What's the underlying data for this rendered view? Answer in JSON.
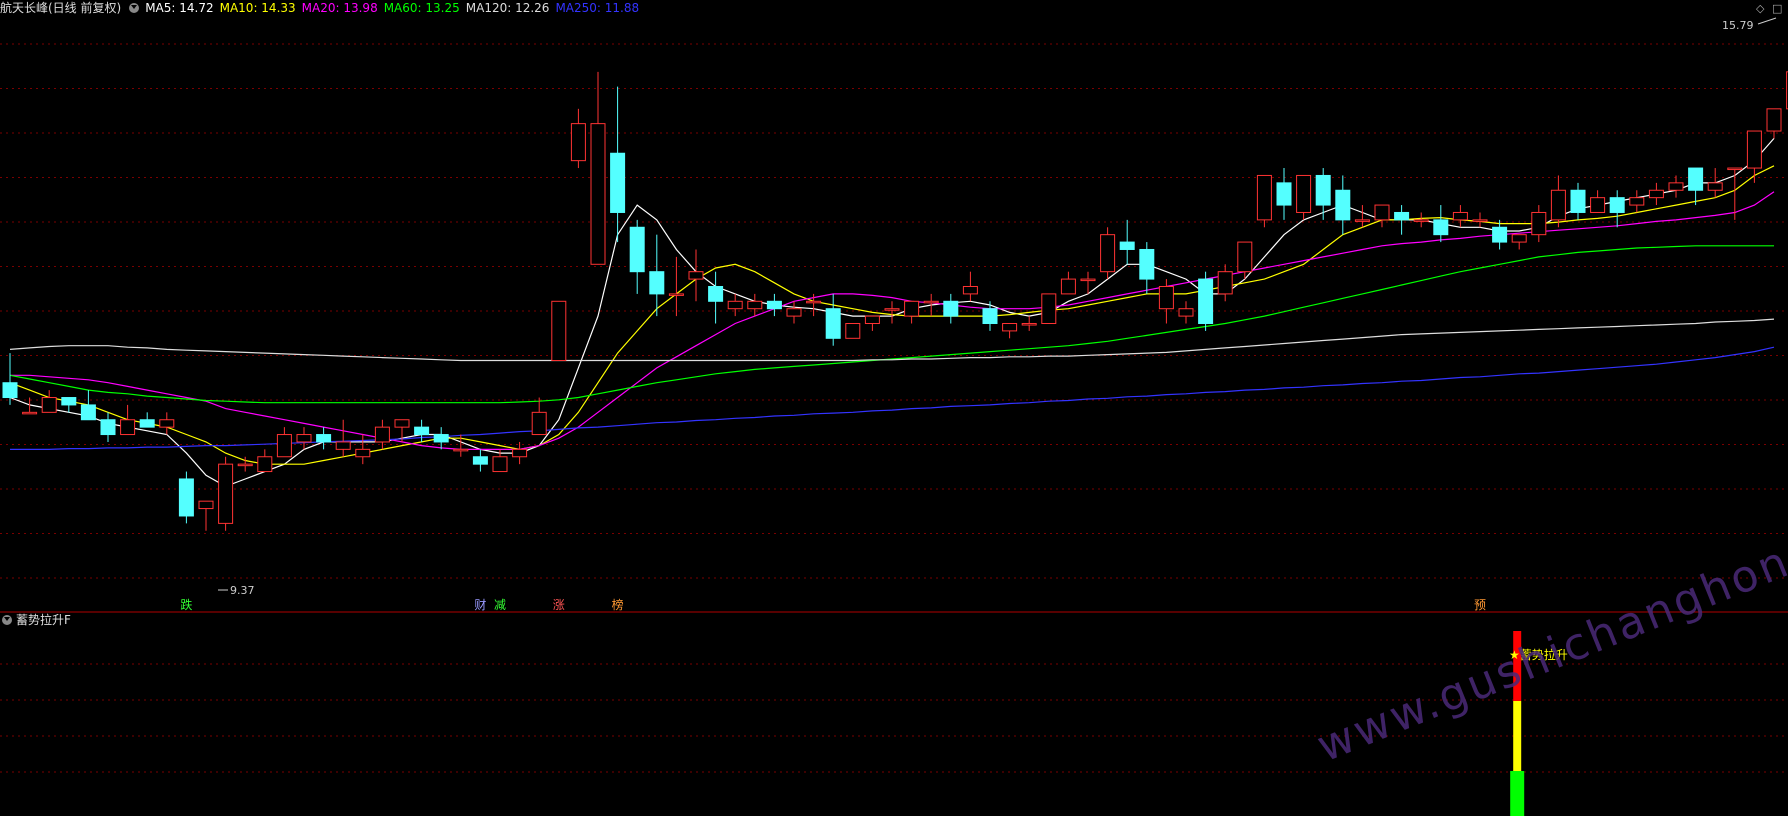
{
  "header": {
    "stock_name": "航天长峰(日线 前复权)",
    "ma_items": [
      {
        "label": "MA5: 14.72",
        "color": "#ffffff"
      },
      {
        "label": "MA10: 14.33",
        "color": "#ffff00"
      },
      {
        "label": "MA20: 13.98",
        "color": "#ff00ff"
      },
      {
        "label": "MA60: 13.25",
        "color": "#00ff00"
      },
      {
        "label": "MA120: 12.26",
        "color": "#dddddd"
      },
      {
        "label": "MA250: 11.88",
        "color": "#3333ff"
      }
    ]
  },
  "indicator": {
    "name": "蓄势拉升F",
    "signal_label": "★蓄势拉升"
  },
  "watermark": "www.gushichanghong.com",
  "colors": {
    "up": "#ff3333",
    "down": "#54ffff",
    "grid": "#7a0000"
  },
  "chart_data": {
    "type": "candlestick",
    "ylim": [
      8.6,
      16.3
    ],
    "max_label": "15.79",
    "min_label": "9.37",
    "candles": [
      [
        11.4,
        11.8,
        11.2,
        11.1
      ],
      [
        11.0,
        11.2,
        11.0,
        11.0
      ],
      [
        11.0,
        11.3,
        11.2,
        11.0
      ],
      [
        11.2,
        11.2,
        11.1,
        11.0
      ],
      [
        11.1,
        11.3,
        10.9,
        10.9
      ],
      [
        10.9,
        11.0,
        10.7,
        10.6
      ],
      [
        10.7,
        11.1,
        10.9,
        10.7
      ],
      [
        10.9,
        11.0,
        10.8,
        10.8
      ],
      [
        10.8,
        11.0,
        10.9,
        10.7
      ],
      [
        10.1,
        10.2,
        9.6,
        9.5
      ],
      [
        9.7,
        9.8,
        9.8,
        9.4
      ],
      [
        9.5,
        10.4,
        10.3,
        9.4
      ],
      [
        10.3,
        10.4,
        10.3,
        10.2
      ],
      [
        10.2,
        10.5,
        10.4,
        10.2
      ],
      [
        10.4,
        10.8,
        10.7,
        10.4
      ],
      [
        10.6,
        10.8,
        10.7,
        10.5
      ],
      [
        10.7,
        10.8,
        10.6,
        10.5
      ],
      [
        10.5,
        10.9,
        10.6,
        10.4
      ],
      [
        10.4,
        10.7,
        10.5,
        10.3
      ],
      [
        10.6,
        10.9,
        10.8,
        10.5
      ],
      [
        10.8,
        10.9,
        10.9,
        10.6
      ],
      [
        10.8,
        10.9,
        10.7,
        10.6
      ],
      [
        10.7,
        10.8,
        10.6,
        10.5
      ],
      [
        10.5,
        10.7,
        10.5,
        10.4
      ],
      [
        10.4,
        10.5,
        10.3,
        10.2
      ],
      [
        10.2,
        10.5,
        10.4,
        10.2
      ],
      [
        10.4,
        10.6,
        10.5,
        10.3
      ],
      [
        10.7,
        11.2,
        11.0,
        10.7
      ],
      [
        11.7,
        12.5,
        12.5,
        11.7
      ],
      [
        14.4,
        15.1,
        14.9,
        14.3
      ],
      [
        13.0,
        15.6,
        14.9,
        13.0
      ],
      [
        14.5,
        15.4,
        13.7,
        13.3
      ],
      [
        13.5,
        13.6,
        12.9,
        12.6
      ],
      [
        12.9,
        13.4,
        12.6,
        12.3
      ],
      [
        12.6,
        13.1,
        12.6,
        12.3
      ],
      [
        12.8,
        13.2,
        12.9,
        12.5
      ],
      [
        12.7,
        12.9,
        12.5,
        12.2
      ],
      [
        12.4,
        12.6,
        12.5,
        12.3
      ],
      [
        12.4,
        12.6,
        12.5,
        12.3
      ],
      [
        12.5,
        12.6,
        12.4,
        12.3
      ],
      [
        12.3,
        12.5,
        12.4,
        12.2
      ],
      [
        12.5,
        12.6,
        12.5,
        12.3
      ],
      [
        12.4,
        12.6,
        12.0,
        11.9
      ],
      [
        12.0,
        12.2,
        12.2,
        12.0
      ],
      [
        12.2,
        12.3,
        12.3,
        12.1
      ],
      [
        12.4,
        12.5,
        12.4,
        12.2
      ],
      [
        12.3,
        12.5,
        12.5,
        12.2
      ],
      [
        12.5,
        12.6,
        12.5,
        12.3
      ],
      [
        12.5,
        12.6,
        12.3,
        12.2
      ],
      [
        12.6,
        12.9,
        12.7,
        12.5
      ],
      [
        12.4,
        12.5,
        12.2,
        12.1
      ],
      [
        12.1,
        12.2,
        12.2,
        12.0
      ],
      [
        12.2,
        12.3,
        12.2,
        12.1
      ],
      [
        12.2,
        12.5,
        12.6,
        12.2
      ],
      [
        12.6,
        12.9,
        12.8,
        12.6
      ],
      [
        12.8,
        12.9,
        12.8,
        12.6
      ],
      [
        12.9,
        13.5,
        13.4,
        12.8
      ],
      [
        13.3,
        13.6,
        13.2,
        13.0
      ],
      [
        13.2,
        13.3,
        12.8,
        12.6
      ],
      [
        12.4,
        12.8,
        12.7,
        12.2
      ],
      [
        12.3,
        12.5,
        12.4,
        12.2
      ],
      [
        12.8,
        12.9,
        12.2,
        12.1
      ],
      [
        12.6,
        13.0,
        12.9,
        12.5
      ],
      [
        12.9,
        13.2,
        13.3,
        12.8
      ],
      [
        13.6,
        14.1,
        14.2,
        13.5
      ],
      [
        14.1,
        14.3,
        13.8,
        13.6
      ],
      [
        13.7,
        14.2,
        14.2,
        13.6
      ],
      [
        14.2,
        14.3,
        13.8,
        13.6
      ],
      [
        14.0,
        14.2,
        13.6,
        13.4
      ],
      [
        13.6,
        13.8,
        13.6,
        13.5
      ],
      [
        13.6,
        13.8,
        13.8,
        13.5
      ],
      [
        13.7,
        13.8,
        13.6,
        13.4
      ],
      [
        13.6,
        13.7,
        13.6,
        13.5
      ],
      [
        13.6,
        13.8,
        13.4,
        13.3
      ],
      [
        13.6,
        13.8,
        13.7,
        13.5
      ],
      [
        13.6,
        13.7,
        13.6,
        13.5
      ],
      [
        13.5,
        13.6,
        13.3,
        13.2
      ],
      [
        13.3,
        13.4,
        13.4,
        13.2
      ],
      [
        13.4,
        13.8,
        13.7,
        13.3
      ],
      [
        13.6,
        14.2,
        14.0,
        13.5
      ],
      [
        14.0,
        14.1,
        13.7,
        13.6
      ],
      [
        13.7,
        14.0,
        13.9,
        13.7
      ],
      [
        13.9,
        14.0,
        13.7,
        13.5
      ],
      [
        13.8,
        14.0,
        13.9,
        13.7
      ],
      [
        13.9,
        14.1,
        14.0,
        13.8
      ],
      [
        14.0,
        14.2,
        14.1,
        13.9
      ],
      [
        14.3,
        14.3,
        14.0,
        13.8
      ],
      [
        14.0,
        14.3,
        14.1,
        13.9
      ],
      [
        14.3,
        14.3,
        14.3,
        13.6
      ],
      [
        14.3,
        14.5,
        14.8,
        14.1
      ],
      [
        14.8,
        14.8,
        15.1,
        14.7
      ],
      [
        15.1,
        15.6,
        15.6,
        15.0
      ]
    ],
    "ma_lines": [
      {
        "name": "MA5",
        "color": "#ffffff",
        "values": [
          11.2,
          11.1,
          11.05,
          11.0,
          10.95,
          10.85,
          10.8,
          10.75,
          10.7,
          10.45,
          10.15,
          10.0,
          10.1,
          10.2,
          10.3,
          10.5,
          10.6,
          10.6,
          10.6,
          10.6,
          10.65,
          10.7,
          10.7,
          10.6,
          10.5,
          10.45,
          10.45,
          10.55,
          10.9,
          11.6,
          12.3,
          13.4,
          13.8,
          13.6,
          13.2,
          12.9,
          12.7,
          12.6,
          12.5,
          12.45,
          12.42,
          12.4,
          12.35,
          12.3,
          12.3,
          12.3,
          12.4,
          12.45,
          12.48,
          12.5,
          12.45,
          12.35,
          12.3,
          12.35,
          12.5,
          12.6,
          12.8,
          13.0,
          13.0,
          12.9,
          12.8,
          12.6,
          12.6,
          12.8,
          13.1,
          13.4,
          13.6,
          13.7,
          13.8,
          13.7,
          13.6,
          13.6,
          13.6,
          13.55,
          13.5,
          13.5,
          13.45,
          13.45,
          13.5,
          13.65,
          13.75,
          13.8,
          13.85,
          13.9,
          13.95,
          14.0,
          14.1,
          14.1,
          14.2,
          14.4,
          14.7
        ]
      },
      {
        "name": "MA10",
        "color": "#ffff00",
        "values": [
          11.4,
          11.3,
          11.2,
          11.15,
          11.1,
          11.0,
          10.9,
          10.85,
          10.8,
          10.7,
          10.6,
          10.45,
          10.35,
          10.3,
          10.3,
          10.3,
          10.35,
          10.4,
          10.45,
          10.5,
          10.55,
          10.6,
          10.65,
          10.65,
          10.6,
          10.55,
          10.5,
          10.55,
          10.7,
          11.0,
          11.4,
          11.8,
          12.1,
          12.4,
          12.6,
          12.8,
          12.95,
          13.0,
          12.9,
          12.75,
          12.6,
          12.5,
          12.45,
          12.4,
          12.35,
          12.32,
          12.3,
          12.3,
          12.3,
          12.3,
          12.3,
          12.32,
          12.35,
          12.38,
          12.4,
          12.45,
          12.5,
          12.55,
          12.6,
          12.6,
          12.6,
          12.65,
          12.7,
          12.75,
          12.8,
          12.9,
          13.0,
          13.2,
          13.4,
          13.5,
          13.6,
          13.6,
          13.62,
          13.63,
          13.6,
          13.58,
          13.55,
          13.55,
          13.55,
          13.57,
          13.6,
          13.62,
          13.65,
          13.7,
          13.75,
          13.8,
          13.85,
          13.9,
          14.0,
          14.2,
          14.33
        ]
      },
      {
        "name": "MA20",
        "color": "#ff00ff",
        "values": [
          11.5,
          11.5,
          11.48,
          11.46,
          11.44,
          11.4,
          11.35,
          11.3,
          11.25,
          11.2,
          11.15,
          11.05,
          11.0,
          10.95,
          10.9,
          10.85,
          10.8,
          10.75,
          10.7,
          10.65,
          10.6,
          10.55,
          10.52,
          10.5,
          10.5,
          10.5,
          10.5,
          10.55,
          10.65,
          10.8,
          11.0,
          11.2,
          11.4,
          11.6,
          11.75,
          11.9,
          12.05,
          12.2,
          12.3,
          12.4,
          12.5,
          12.55,
          12.6,
          12.6,
          12.58,
          12.55,
          12.5,
          12.48,
          12.45,
          12.42,
          12.4,
          12.4,
          12.4,
          12.42,
          12.45,
          12.5,
          12.55,
          12.6,
          12.65,
          12.7,
          12.75,
          12.8,
          12.85,
          12.9,
          12.95,
          13.0,
          13.05,
          13.1,
          13.15,
          13.2,
          13.25,
          13.28,
          13.3,
          13.33,
          13.35,
          13.38,
          13.4,
          13.42,
          13.44,
          13.46,
          13.48,
          13.5,
          13.52,
          13.55,
          13.58,
          13.6,
          13.63,
          13.66,
          13.7,
          13.8,
          13.98
        ]
      },
      {
        "name": "MA60",
        "color": "#00ff00",
        "values": [
          11.5,
          11.45,
          11.4,
          11.35,
          11.3,
          11.27,
          11.25,
          11.22,
          11.2,
          11.18,
          11.16,
          11.15,
          11.14,
          11.13,
          11.13,
          11.13,
          11.13,
          11.13,
          11.13,
          11.13,
          11.13,
          11.13,
          11.13,
          11.13,
          11.13,
          11.13,
          11.14,
          11.15,
          11.17,
          11.2,
          11.25,
          11.3,
          11.35,
          11.4,
          11.44,
          11.48,
          11.52,
          11.55,
          11.58,
          11.6,
          11.62,
          11.64,
          11.66,
          11.68,
          11.7,
          11.72,
          11.74,
          11.76,
          11.78,
          11.8,
          11.82,
          11.84,
          11.86,
          11.88,
          11.9,
          11.93,
          11.96,
          12.0,
          12.04,
          12.08,
          12.12,
          12.16,
          12.2,
          12.25,
          12.3,
          12.36,
          12.42,
          12.48,
          12.54,
          12.6,
          12.66,
          12.72,
          12.78,
          12.84,
          12.9,
          12.95,
          13.0,
          13.05,
          13.1,
          13.13,
          13.16,
          13.18,
          13.2,
          13.22,
          13.23,
          13.24,
          13.25,
          13.25,
          13.25,
          13.25,
          13.25
        ]
      },
      {
        "name": "MA120",
        "color": "#dddddd",
        "values": [
          11.85,
          11.87,
          11.89,
          11.9,
          11.9,
          11.9,
          11.88,
          11.87,
          11.85,
          11.84,
          11.83,
          11.82,
          11.81,
          11.8,
          11.79,
          11.78,
          11.77,
          11.76,
          11.75,
          11.74,
          11.73,
          11.72,
          11.71,
          11.7,
          11.7,
          11.7,
          11.7,
          11.7,
          11.7,
          11.7,
          11.7,
          11.7,
          11.7,
          11.7,
          11.7,
          11.7,
          11.7,
          11.7,
          11.7,
          11.7,
          11.7,
          11.7,
          11.7,
          11.7,
          11.71,
          11.71,
          11.72,
          11.72,
          11.73,
          11.74,
          11.74,
          11.75,
          11.75,
          11.76,
          11.76,
          11.77,
          11.78,
          11.79,
          11.8,
          11.81,
          11.83,
          11.85,
          11.87,
          11.89,
          11.91,
          11.93,
          11.95,
          11.97,
          11.99,
          12.01,
          12.03,
          12.05,
          12.06,
          12.07,
          12.08,
          12.09,
          12.1,
          12.11,
          12.12,
          12.13,
          12.14,
          12.15,
          12.16,
          12.17,
          12.18,
          12.19,
          12.2,
          12.22,
          12.23,
          12.24,
          12.26
        ]
      },
      {
        "name": "MA250",
        "color": "#3333ff",
        "values": [
          10.5,
          10.5,
          10.5,
          10.51,
          10.51,
          10.52,
          10.52,
          10.53,
          10.53,
          10.54,
          10.55,
          10.55,
          10.56,
          10.57,
          10.58,
          10.59,
          10.6,
          10.61,
          10.62,
          10.63,
          10.64,
          10.66,
          10.67,
          10.69,
          10.7,
          10.72,
          10.74,
          10.75,
          10.77,
          10.79,
          10.8,
          10.82,
          10.84,
          10.86,
          10.87,
          10.89,
          10.9,
          10.92,
          10.93,
          10.95,
          10.96,
          10.98,
          10.99,
          11.0,
          11.02,
          11.03,
          11.05,
          11.06,
          11.08,
          11.09,
          11.1,
          11.12,
          11.13,
          11.15,
          11.16,
          11.18,
          11.19,
          11.21,
          11.22,
          11.24,
          11.25,
          11.27,
          11.28,
          11.3,
          11.31,
          11.33,
          11.34,
          11.36,
          11.37,
          11.39,
          11.4,
          11.42,
          11.43,
          11.45,
          11.47,
          11.48,
          11.5,
          11.52,
          11.53,
          11.55,
          11.57,
          11.59,
          11.61,
          11.63,
          11.65,
          11.68,
          11.71,
          11.74,
          11.78,
          11.82,
          11.88
        ]
      }
    ],
    "event_labels": [
      {
        "index": 9,
        "text": "跌",
        "color": "#33ff33"
      },
      {
        "index": 24,
        "text": "财",
        "color": "#9999ff"
      },
      {
        "index": 25,
        "text": "减",
        "color": "#33ff33"
      },
      {
        "index": 28,
        "text": "涨",
        "color": "#ff5555"
      },
      {
        "index": 31,
        "text": "榜",
        "color": "#ff9933"
      },
      {
        "index": 75,
        "text": "预",
        "color": "#ff9933"
      }
    ],
    "signal_index": 77
  }
}
